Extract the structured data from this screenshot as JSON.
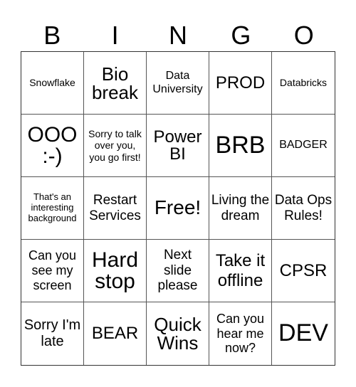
{
  "header": {
    "letters": [
      "B",
      "I",
      "N",
      "G",
      "O"
    ]
  },
  "cells": [
    "Snowflake",
    "Bio break",
    "Data University",
    "PROD",
    "Databricks",
    "OOO :-)",
    "Sorry to talk over you, you go first!",
    "Power BI",
    "BRB",
    "BADGER",
    "That's an interesting background",
    "Restart Services",
    "Free!",
    "Living the dream",
    "Data Ops Rules!",
    "Can you see my screen",
    "Hard stop",
    "Next slide please",
    "Take it offline",
    "CPSR",
    "Sorry I'm late",
    "BEAR",
    "Quick Wins",
    "Can you hear me now?",
    "DEV"
  ],
  "colors": {
    "border": "#555555",
    "text": "#000000",
    "background": "#ffffff"
  }
}
